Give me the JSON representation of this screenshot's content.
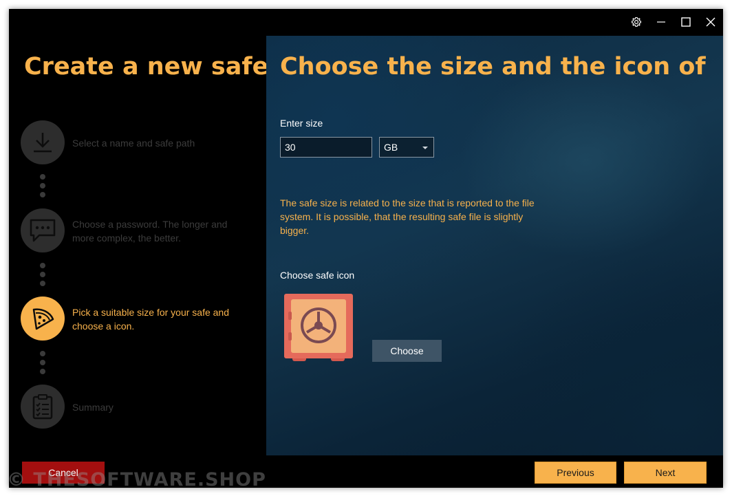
{
  "left": {
    "title": "Create a new safe",
    "steps": [
      {
        "icon": "download-icon",
        "label": "Select a name and safe path",
        "active": false
      },
      {
        "icon": "chat-bubble-icon",
        "label": "Choose a password. The longer and more complex, the better.",
        "active": false
      },
      {
        "icon": "pizza-slice-icon",
        "label": "Pick a suitable size for your safe and choose a icon.",
        "active": true
      },
      {
        "icon": "clipboard-checklist-icon",
        "label": "Summary",
        "active": false
      }
    ]
  },
  "right": {
    "title": "Choose the size and the icon of the safe",
    "size_label": "Enter size",
    "size_value": "30",
    "unit_selected": "GB",
    "info_text": "The safe size is related to the size that is reported to the file system. It is possible, that the resulting safe file is slightly bigger.",
    "icon_label": "Choose safe icon",
    "safe_icon": "safe-icon",
    "choose_button": "Choose"
  },
  "footer": {
    "cancel": "Cancel",
    "previous": "Previous",
    "next": "Next"
  },
  "titlebar_icons": [
    "gear-icon",
    "minimize-icon",
    "maximize-icon",
    "close-icon"
  ],
  "watermark": "© THESOFTWARE.SHOP",
  "colors": {
    "accent": "#f8b24c",
    "cancel": "#a30f0f",
    "background": "#000000",
    "panel": "#0f3552"
  }
}
